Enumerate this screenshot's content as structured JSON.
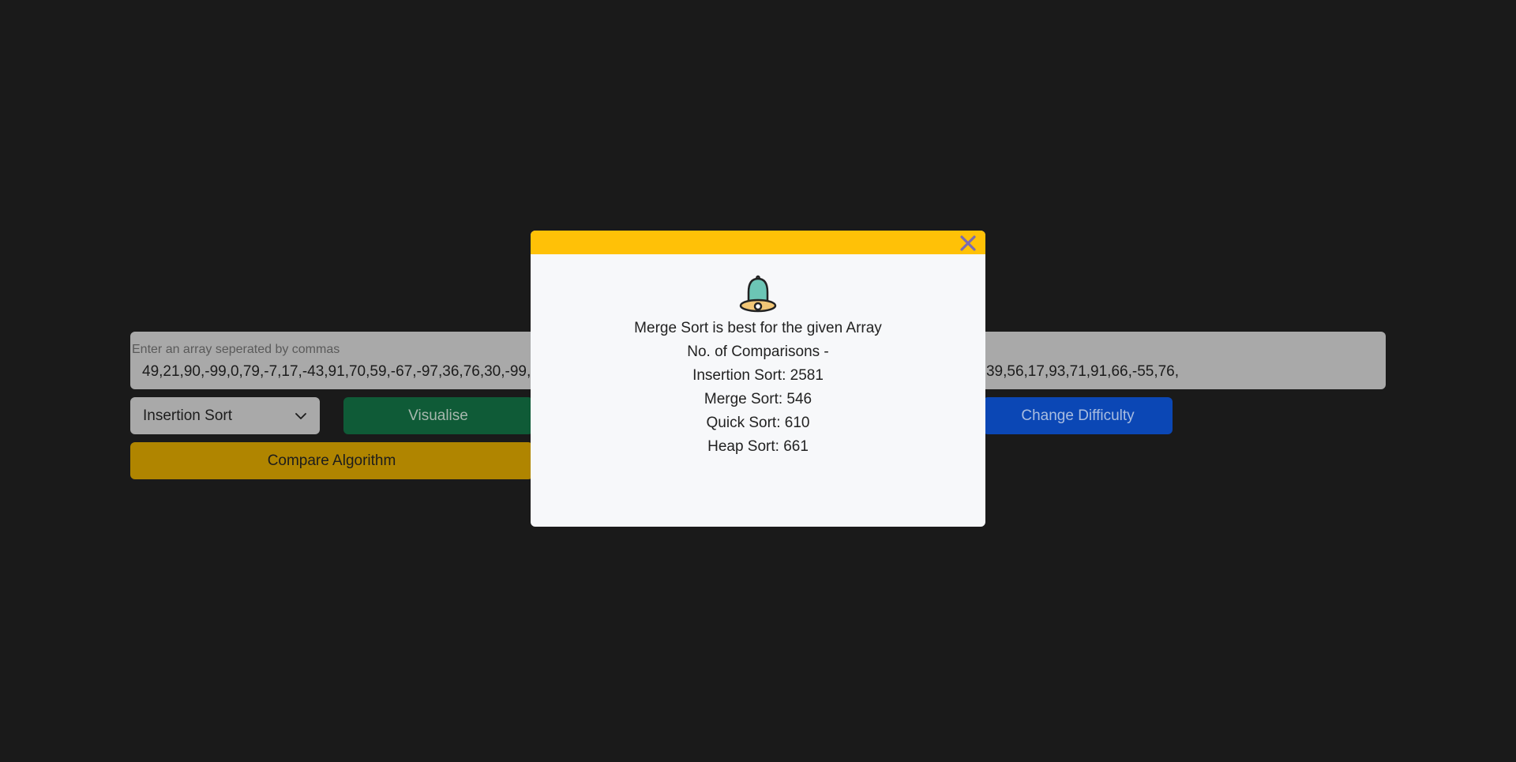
{
  "array_input": {
    "label": "Enter an array seperated by commas",
    "value": "49,21,90,-99,0,79,-7,17,-43,91,70,59,-67,-97,36,76,30,-99,-52,-68,-58,62,48,-25,-96,86,33,-2,44,-94,-43,63,-61,70,79,-12,-5,65,39,56,17,93,71,91,66,-55,76,"
  },
  "controls": {
    "algorithm_select": "Insertion Sort",
    "visualise_label": "Visualise",
    "change_difficulty_label": "Change Difficulty",
    "compare_label": "Compare Algorithm"
  },
  "modal": {
    "message": "Merge Sort is best for the given Array",
    "comparisons_heading": "No. of Comparisons -",
    "results": [
      "Insertion Sort: 2581",
      "Merge Sort: 546",
      "Quick Sort: 610",
      "Heap Sort: 661"
    ]
  },
  "colors": {
    "background": "#1a1a1a",
    "modal_header": "#ffc107",
    "visualise": "#0f5b37",
    "change_difficulty": "#0b47b5",
    "compare": "#b08500",
    "close_icon": "#7b6bb3"
  },
  "icons": {
    "close": "close-icon",
    "bell": "bell-icon",
    "dropdown": "chevron-down-icon"
  }
}
